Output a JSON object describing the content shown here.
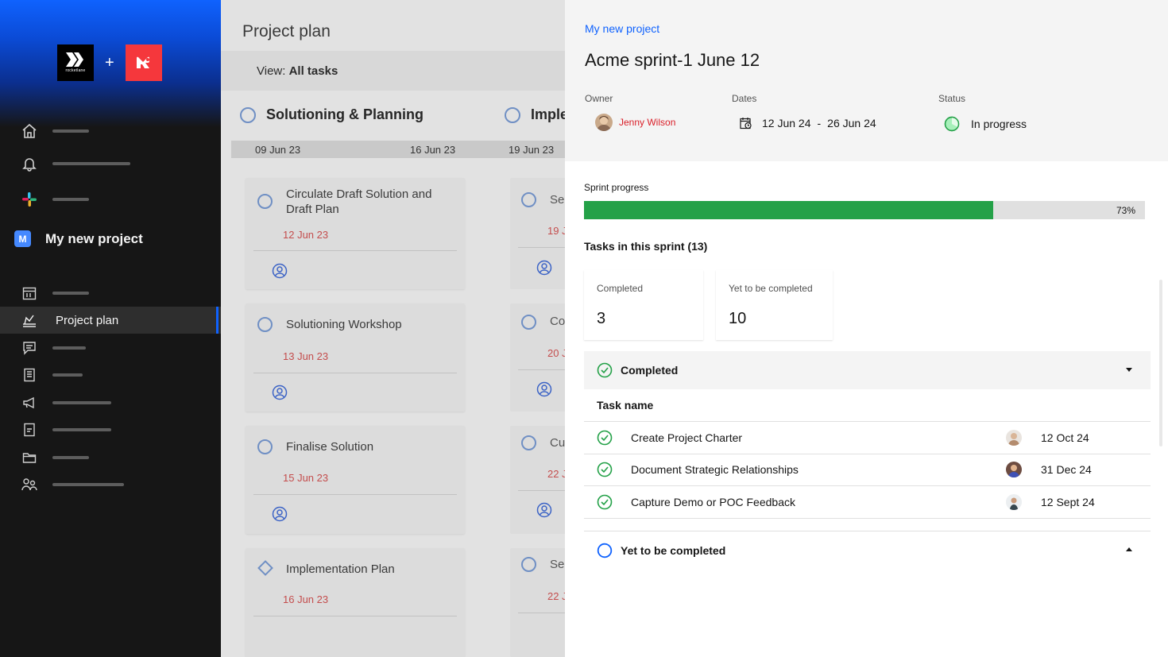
{
  "sidebar": {
    "logo_a_text": "rocketlane",
    "logo_plus": "+",
    "project_badge": "M",
    "project_name": "My new project",
    "active_item": "Project plan",
    "colors": {
      "background": "#161616",
      "accent": "#0f62fe"
    }
  },
  "board": {
    "title": "Project plan",
    "view_prefix": "View:",
    "view_value": "All tasks",
    "columns": [
      {
        "label": "Solutioning & Planning"
      },
      {
        "label": "Imple"
      }
    ],
    "timeline": [
      "09 Jun 23",
      "16 Jun 23",
      "19 Jun 23"
    ],
    "cards": [
      {
        "title": "Circulate Draft Solution and Draft Plan",
        "date": "12 Jun 23"
      },
      {
        "title": "Solutioning Workshop",
        "date": "13 Jun 23"
      },
      {
        "title": "Finalise Solution",
        "date": "15 Jun 23"
      },
      {
        "title": "Implementation Plan",
        "date": "16 Jun 23"
      }
    ],
    "cards_right": [
      {
        "title": "Se",
        "date": "19 J"
      },
      {
        "title": "Co",
        "date": "20 J"
      },
      {
        "title": "Cu",
        "date": "22 J"
      },
      {
        "title": "Se",
        "date": "22 J"
      }
    ]
  },
  "panel": {
    "breadcrumb": "My new project",
    "title": "Acme sprint-1 June 12",
    "owner_label": "Owner",
    "owner_name": "Jenny Wilson",
    "dates_label": "Dates",
    "date_start": "12 Jun 24",
    "date_sep": "-",
    "date_end": "26 Jun 24",
    "status_label": "Status",
    "status_value": "In progress",
    "progress_label": "Sprint progress",
    "progress_percent": 73,
    "progress_text": "73%",
    "tasks_heading": "Tasks in this sprint (13)",
    "tiles": [
      {
        "label": "Completed",
        "value": "3"
      },
      {
        "label": "Yet to be completed",
        "value": "10"
      }
    ],
    "completed_section": "Completed",
    "table_header": "Task name",
    "rows": [
      {
        "name": "Create Project Charter",
        "date": "12 Oct 24"
      },
      {
        "name": "Document Strategic Relationships",
        "date": "31 Dec 24"
      },
      {
        "name": "Capture Demo or POC Feedback",
        "date": "12 Sept 24"
      }
    ],
    "pending_section": "Yet to be completed",
    "colors": {
      "link": "#0f62fe",
      "success": "#24a148",
      "owner": "#da1e28",
      "pending_ring": "#0f62fe"
    }
  }
}
